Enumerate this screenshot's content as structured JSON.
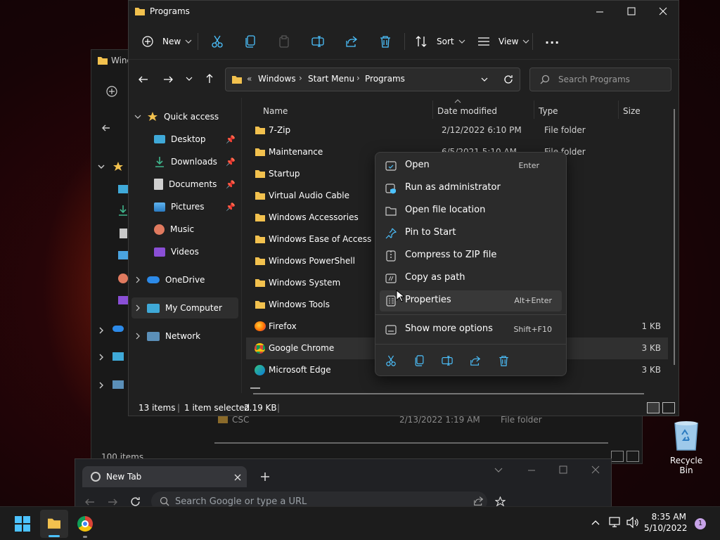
{
  "background_window": {
    "title": "Windows",
    "status_items": "100 items",
    "row": {
      "name": "CSC",
      "date": "2/13/2022 1:19 AM",
      "type": "File folder"
    }
  },
  "window": {
    "title": "Programs",
    "toolbar": {
      "new_label": "New",
      "sort_label": "Sort",
      "view_label": "View",
      "more_label": "..."
    },
    "address": {
      "overflow": "«",
      "crumbs": [
        "Windows",
        "Start Menu",
        "Programs"
      ]
    },
    "search": {
      "placeholder": "Search Programs"
    },
    "sidebar": {
      "quick_access": "Quick access",
      "items": [
        {
          "label": "Desktop"
        },
        {
          "label": "Downloads"
        },
        {
          "label": "Documents"
        },
        {
          "label": "Pictures"
        },
        {
          "label": "Music"
        },
        {
          "label": "Videos"
        }
      ],
      "onedrive": "OneDrive",
      "my_computer": "My Computer",
      "network": "Network"
    },
    "columns": {
      "name": "Name",
      "date": "Date modified",
      "type": "Type",
      "size": "Size"
    },
    "rows": [
      {
        "name": "7-Zip",
        "date": "2/12/2022 6:10 PM",
        "type": "File folder",
        "size": ""
      },
      {
        "name": "Maintenance",
        "date": "6/5/2021 5:10 AM",
        "type": "File folder",
        "size": ""
      },
      {
        "name": "Startup",
        "date": "",
        "type": "",
        "size": ""
      },
      {
        "name": "Virtual Audio Cable",
        "date": "",
        "type": "",
        "size": ""
      },
      {
        "name": "Windows Accessories",
        "date": "",
        "type": "",
        "size": ""
      },
      {
        "name": "Windows Ease of Access",
        "date": "",
        "type": "",
        "size": ""
      },
      {
        "name": "Windows PowerShell",
        "date": "",
        "type": "",
        "size": ""
      },
      {
        "name": "Windows System",
        "date": "",
        "type": "",
        "size": ""
      },
      {
        "name": "Windows Tools",
        "date": "",
        "type": "",
        "size": ""
      },
      {
        "name": "Firefox",
        "date": "",
        "type": "",
        "size": "1 KB"
      },
      {
        "name": "Google Chrome",
        "date": "",
        "type": "",
        "size": "3 KB"
      },
      {
        "name": "Microsoft Edge",
        "date": "",
        "type": "",
        "size": "3 KB"
      }
    ],
    "status": {
      "count": "13 items",
      "selected": "1 item selected",
      "size": "2.19 KB"
    }
  },
  "context_menu": {
    "items": [
      {
        "label": "Open",
        "shortcut": "Enter"
      },
      {
        "label": "Run as administrator",
        "shortcut": ""
      },
      {
        "label": "Open file location",
        "shortcut": ""
      },
      {
        "label": "Pin to Start",
        "shortcut": ""
      },
      {
        "label": "Compress to ZIP file",
        "shortcut": ""
      },
      {
        "label": "Copy as path",
        "shortcut": ""
      },
      {
        "label": "Properties",
        "shortcut": "Alt+Enter"
      },
      {
        "label": "Show more options",
        "shortcut": "Shift+F10"
      }
    ]
  },
  "chrome": {
    "tab_title": "New Tab",
    "omnibox_placeholder": "Search Google or type a URL"
  },
  "desktop": {
    "recycle_bin": "Recycle Bin"
  },
  "taskbar": {
    "time": "8:35 AM",
    "date": "5/10/2022",
    "notification_count": "1"
  },
  "colors": {
    "accent": "#4cc2ff",
    "folder": "#f2c14e",
    "window_bg": "#202020",
    "menu_bg": "#2b2b2b"
  }
}
